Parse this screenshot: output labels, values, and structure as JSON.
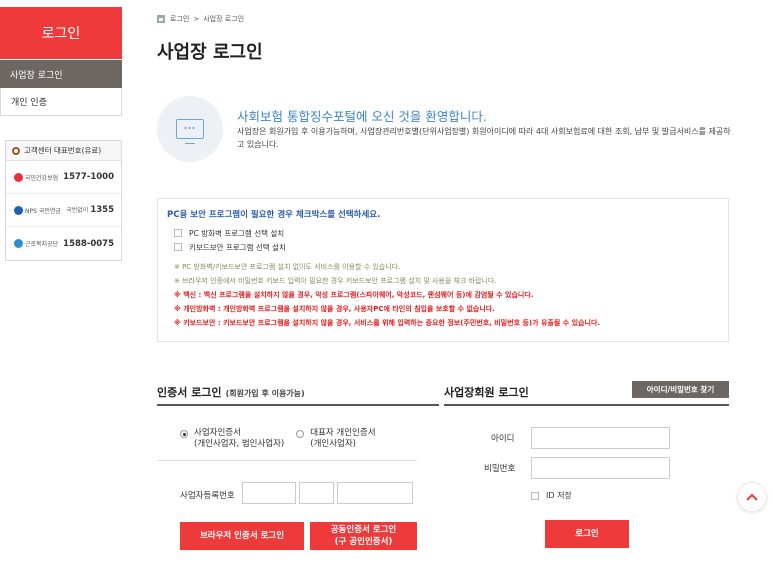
{
  "sidebar": {
    "title": "로그인",
    "items": [
      {
        "label": "사업장 로그인",
        "active": true
      },
      {
        "label": "개인 인증",
        "active": false
      }
    ],
    "customer_center": {
      "title": "고객센터 대표번호(유료)",
      "rows": [
        {
          "org": "국민건강보험",
          "number": "1577-1000",
          "prefix": ""
        },
        {
          "org": "NPS 국민연금",
          "number": "1355",
          "prefix": "국번없이"
        },
        {
          "org": "근로복지공단",
          "number": "1588-0075",
          "prefix": ""
        }
      ]
    }
  },
  "breadcrumb": {
    "items": [
      "로그인",
      "사업장 로그인"
    ],
    "separator": ">"
  },
  "page_title": "사업장 로그인",
  "welcome": {
    "icon_text": "***",
    "title": "사회보험 통합징수포털에 오신 것을 환영합니다.",
    "desc": "사업장은 회원가입 후 이용가능하며, 사업장관리번호별(단위사업장별) 회원아이디에 따라 4대 사회보험료에 대한 조회, 납부 및 발급서비스를 제공하고 있습니다."
  },
  "security": {
    "title": "PC용 보안 프로그램이 필요한 경우 체크박스를 선택하세요.",
    "options": [
      "PC 방화벽 프로그램 선택 설치",
      "키보드보안 프로그램 선택 설치"
    ],
    "notes": [
      {
        "text": "※ PC 방화벽/키보드보안 프로그램 설치 없이도 서비스를 이용할 수 있습니다.",
        "red": false
      },
      {
        "text": "※ 브라우저 인증에서 비밀번호 키보드 입력이 필요한 경우 키보드보안 프로그램 설치 및 사용을 체크 바랍니다.",
        "red": false
      },
      {
        "text": "※ 백신 : 백신 프로그램을 설치하지 않을 경우, 악성 프로그램(스파이웨어, 악성코드, 랜섬웨어 등)에 감염될 수 있습니다.",
        "red": true
      },
      {
        "text": "※ 개인방화벽 : 개인방화벽 프로그램을 설치하지 않을 경우, 사용자PC에 타인의 침입을 보호할 수 없습니다.",
        "red": true
      },
      {
        "text": "※ 키보드보안 : 키보드보안 프로그램을 설치하지 않을 경우, 서비스를 위해 입력하는 중요한 정보(주민번호, 비밀번호 등)가 유출될 수 있습니다.",
        "red": true
      }
    ]
  },
  "cert_login": {
    "title": "인증서 로그인",
    "subtitle": "(회원가입 후 이용가능)",
    "radios": [
      {
        "line1": "사업자인증서",
        "line2": "(개인사업자, 법인사업자)",
        "checked": true
      },
      {
        "line1": "대표자 개인인증서",
        "line2": "(개인사업자)",
        "checked": false
      }
    ],
    "biz_number_label": "사업자등록번호",
    "browser_btn": "브라우저 인증서 로그인",
    "joint_btn_line1": "공동인증서 로그인",
    "joint_btn_line2": "(구 공인인증서)"
  },
  "member_login": {
    "title": "사업장회원 로그인",
    "find_btn": "아이디/비밀번호 찾기",
    "id_label": "아이디",
    "pw_label": "비밀번호",
    "id_save_label": "ID 저장",
    "login_btn": "로그인"
  },
  "colors": {
    "accent": "#ee3a3b",
    "sidebar_active": "#6d6764",
    "welcome_blue": "#3d85c6",
    "security_blue": "#2a5caa",
    "warning_red": "#e02020"
  },
  "icons": {
    "home": "home-icon",
    "headset": "phone-icon",
    "scroll_top": "chevron-up-icon"
  }
}
